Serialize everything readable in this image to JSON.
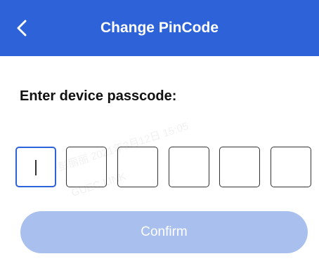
{
  "header": {
    "title": "Change PinCode",
    "back_icon": "chevron-left-icon",
    "background": "#2e62d9"
  },
  "prompt": {
    "label": "Enter device passcode:"
  },
  "pin": {
    "length": 6,
    "entered": "",
    "active_index": 0,
    "active_color": "#2e62d9"
  },
  "confirm": {
    "label": "Confirm",
    "enabled": false,
    "color": "#a9c0ef"
  },
  "watermark": {
    "line1": "彭丽丽 2021年3月12日 15:05",
    "line2": "GUEC LINK"
  }
}
